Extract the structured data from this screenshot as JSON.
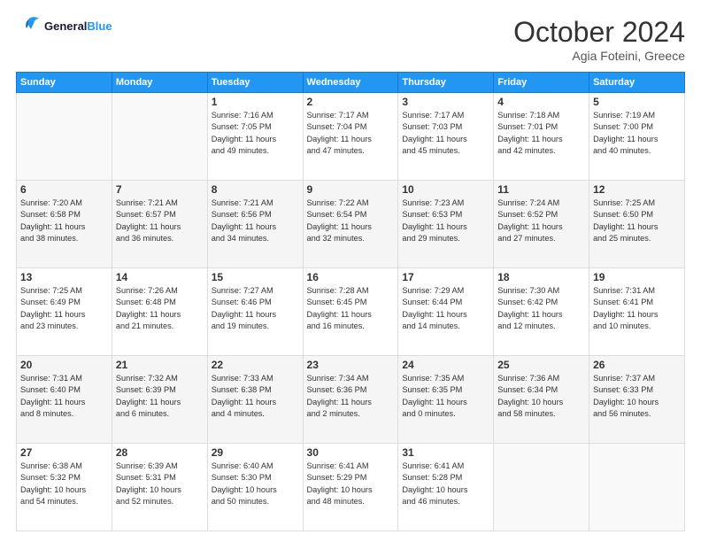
{
  "header": {
    "logo_line1": "General",
    "logo_line2": "Blue",
    "month": "October 2024",
    "location": "Agia Foteini, Greece"
  },
  "weekdays": [
    "Sunday",
    "Monday",
    "Tuesday",
    "Wednesday",
    "Thursday",
    "Friday",
    "Saturday"
  ],
  "weeks": [
    [
      {
        "day": "",
        "info": ""
      },
      {
        "day": "",
        "info": ""
      },
      {
        "day": "1",
        "info": "Sunrise: 7:16 AM\nSunset: 7:05 PM\nDaylight: 11 hours\nand 49 minutes."
      },
      {
        "day": "2",
        "info": "Sunrise: 7:17 AM\nSunset: 7:04 PM\nDaylight: 11 hours\nand 47 minutes."
      },
      {
        "day": "3",
        "info": "Sunrise: 7:17 AM\nSunset: 7:03 PM\nDaylight: 11 hours\nand 45 minutes."
      },
      {
        "day": "4",
        "info": "Sunrise: 7:18 AM\nSunset: 7:01 PM\nDaylight: 11 hours\nand 42 minutes."
      },
      {
        "day": "5",
        "info": "Sunrise: 7:19 AM\nSunset: 7:00 PM\nDaylight: 11 hours\nand 40 minutes."
      }
    ],
    [
      {
        "day": "6",
        "info": "Sunrise: 7:20 AM\nSunset: 6:58 PM\nDaylight: 11 hours\nand 38 minutes."
      },
      {
        "day": "7",
        "info": "Sunrise: 7:21 AM\nSunset: 6:57 PM\nDaylight: 11 hours\nand 36 minutes."
      },
      {
        "day": "8",
        "info": "Sunrise: 7:21 AM\nSunset: 6:56 PM\nDaylight: 11 hours\nand 34 minutes."
      },
      {
        "day": "9",
        "info": "Sunrise: 7:22 AM\nSunset: 6:54 PM\nDaylight: 11 hours\nand 32 minutes."
      },
      {
        "day": "10",
        "info": "Sunrise: 7:23 AM\nSunset: 6:53 PM\nDaylight: 11 hours\nand 29 minutes."
      },
      {
        "day": "11",
        "info": "Sunrise: 7:24 AM\nSunset: 6:52 PM\nDaylight: 11 hours\nand 27 minutes."
      },
      {
        "day": "12",
        "info": "Sunrise: 7:25 AM\nSunset: 6:50 PM\nDaylight: 11 hours\nand 25 minutes."
      }
    ],
    [
      {
        "day": "13",
        "info": "Sunrise: 7:25 AM\nSunset: 6:49 PM\nDaylight: 11 hours\nand 23 minutes."
      },
      {
        "day": "14",
        "info": "Sunrise: 7:26 AM\nSunset: 6:48 PM\nDaylight: 11 hours\nand 21 minutes."
      },
      {
        "day": "15",
        "info": "Sunrise: 7:27 AM\nSunset: 6:46 PM\nDaylight: 11 hours\nand 19 minutes."
      },
      {
        "day": "16",
        "info": "Sunrise: 7:28 AM\nSunset: 6:45 PM\nDaylight: 11 hours\nand 16 minutes."
      },
      {
        "day": "17",
        "info": "Sunrise: 7:29 AM\nSunset: 6:44 PM\nDaylight: 11 hours\nand 14 minutes."
      },
      {
        "day": "18",
        "info": "Sunrise: 7:30 AM\nSunset: 6:42 PM\nDaylight: 11 hours\nand 12 minutes."
      },
      {
        "day": "19",
        "info": "Sunrise: 7:31 AM\nSunset: 6:41 PM\nDaylight: 11 hours\nand 10 minutes."
      }
    ],
    [
      {
        "day": "20",
        "info": "Sunrise: 7:31 AM\nSunset: 6:40 PM\nDaylight: 11 hours\nand 8 minutes."
      },
      {
        "day": "21",
        "info": "Sunrise: 7:32 AM\nSunset: 6:39 PM\nDaylight: 11 hours\nand 6 minutes."
      },
      {
        "day": "22",
        "info": "Sunrise: 7:33 AM\nSunset: 6:38 PM\nDaylight: 11 hours\nand 4 minutes."
      },
      {
        "day": "23",
        "info": "Sunrise: 7:34 AM\nSunset: 6:36 PM\nDaylight: 11 hours\nand 2 minutes."
      },
      {
        "day": "24",
        "info": "Sunrise: 7:35 AM\nSunset: 6:35 PM\nDaylight: 11 hours\nand 0 minutes."
      },
      {
        "day": "25",
        "info": "Sunrise: 7:36 AM\nSunset: 6:34 PM\nDaylight: 10 hours\nand 58 minutes."
      },
      {
        "day": "26",
        "info": "Sunrise: 7:37 AM\nSunset: 6:33 PM\nDaylight: 10 hours\nand 56 minutes."
      }
    ],
    [
      {
        "day": "27",
        "info": "Sunrise: 6:38 AM\nSunset: 5:32 PM\nDaylight: 10 hours\nand 54 minutes."
      },
      {
        "day": "28",
        "info": "Sunrise: 6:39 AM\nSunset: 5:31 PM\nDaylight: 10 hours\nand 52 minutes."
      },
      {
        "day": "29",
        "info": "Sunrise: 6:40 AM\nSunset: 5:30 PM\nDaylight: 10 hours\nand 50 minutes."
      },
      {
        "day": "30",
        "info": "Sunrise: 6:41 AM\nSunset: 5:29 PM\nDaylight: 10 hours\nand 48 minutes."
      },
      {
        "day": "31",
        "info": "Sunrise: 6:41 AM\nSunset: 5:28 PM\nDaylight: 10 hours\nand 46 minutes."
      },
      {
        "day": "",
        "info": ""
      },
      {
        "day": "",
        "info": ""
      }
    ]
  ]
}
